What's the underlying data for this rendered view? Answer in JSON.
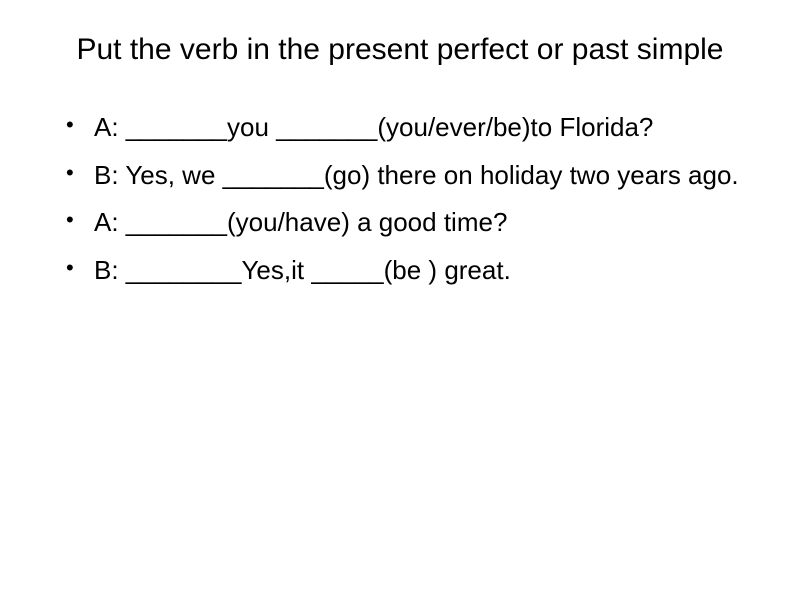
{
  "title": "Put the verb in the present perfect or past simple",
  "items": [
    "A: _______you _______(you/ever/be)to Florida?",
    "B: Yes, we _______(go) there on holiday two years ago.",
    "A: _______(you/have) a good time?",
    "B: ________Yes,it _____(be ) great."
  ]
}
